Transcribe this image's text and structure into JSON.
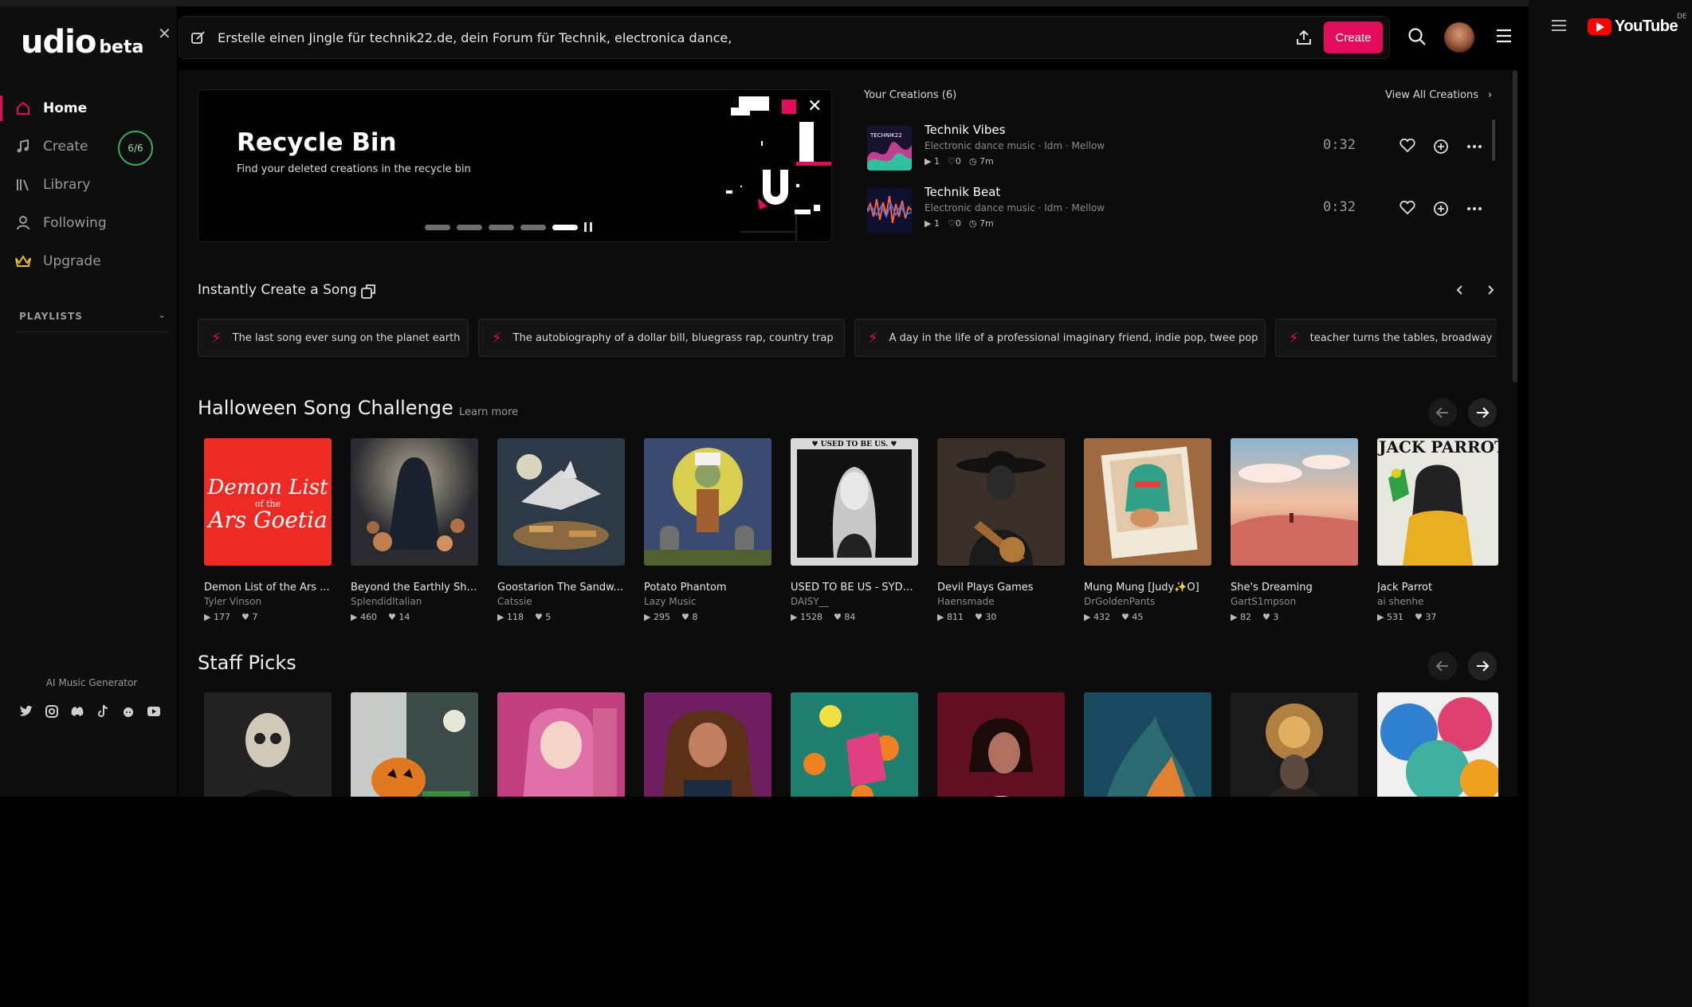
{
  "logo": {
    "word": "udio",
    "tag": "beta"
  },
  "sidebar": {
    "items": [
      {
        "label": "Home"
      },
      {
        "label": "Create",
        "badge": "6/6"
      },
      {
        "label": "Library"
      },
      {
        "label": "Following"
      },
      {
        "label": "Upgrade"
      }
    ],
    "playlists_label": "PLAYLISTS",
    "footer_label": "AI Music Generator"
  },
  "prompt": {
    "value": "Erstelle einen Jingle für technik22.de, dein Forum für Technik, electronica dance,",
    "create_label": "Create"
  },
  "banner": {
    "title": "Recycle Bin",
    "subtitle": "Find your deleted creations in the recycle bin"
  },
  "creations": {
    "title": "Your Creations (6)",
    "view_all": "View All Creations",
    "tracks": [
      {
        "title": "Technik Vibes",
        "tags": "Electronic dance music  ·  Idm  ·  Mellow",
        "plays": "1",
        "likes": "0",
        "age": "7m",
        "duration": "0:32"
      },
      {
        "title": "Technik Beat",
        "tags": "Electronic dance music  ·  Idm  ·  Mellow",
        "plays": "1",
        "likes": "0",
        "age": "7m",
        "duration": "0:32"
      }
    ]
  },
  "instant": {
    "title": "Instantly Create a Song",
    "chips": [
      "The last song ever sung on the planet earth",
      "The autobiography of a dollar bill, bluegrass rap, country trap",
      "A day in the life of a professional imaginary friend, indie pop, twee pop",
      "teacher turns the tables, broadway"
    ]
  },
  "halloween": {
    "title": "Halloween Song Challenge",
    "learn_more": "Learn more",
    "cards": [
      {
        "title": "Demon List of the Ars ...",
        "user": "Tyler Vinson",
        "plays": "177",
        "likes": "7",
        "art_text": "Demon List of the Ars Goetia"
      },
      {
        "title": "Beyond the Earthly Shr...",
        "user": "SplendidItalian",
        "plays": "460",
        "likes": "14"
      },
      {
        "title": "Goostarion The Sandw...",
        "user": "Catssie",
        "plays": "118",
        "likes": "5"
      },
      {
        "title": "Potato Phantom",
        "user": "Lazy Music",
        "plays": "295",
        "likes": "8"
      },
      {
        "title": "USED TO BE US - SYDN...",
        "user": "DAISY__",
        "plays": "1528",
        "likes": "84",
        "art_text": "♥ USED TO BE US. ♥"
      },
      {
        "title": "Devil Plays Games",
        "user": "Haensmade",
        "plays": "811",
        "likes": "30"
      },
      {
        "title": "Mung Mung [Judy✨O]",
        "user": "DrGoldenPants",
        "plays": "432",
        "likes": "45"
      },
      {
        "title": "She's Dreaming",
        "user": "GartS1mpson",
        "plays": "82",
        "likes": "3"
      },
      {
        "title": "Jack Parrot",
        "user": "ai shenhe",
        "plays": "531",
        "likes": "37",
        "art_text": "JACK PARROT"
      }
    ]
  },
  "staff": {
    "title": "Staff Picks"
  },
  "youtube": {
    "word": "YouTube",
    "region": "DE"
  },
  "colors": {
    "accent": "#e30b5c",
    "badge_ring": "#3fae5a",
    "bg": "#0c0c0c"
  }
}
